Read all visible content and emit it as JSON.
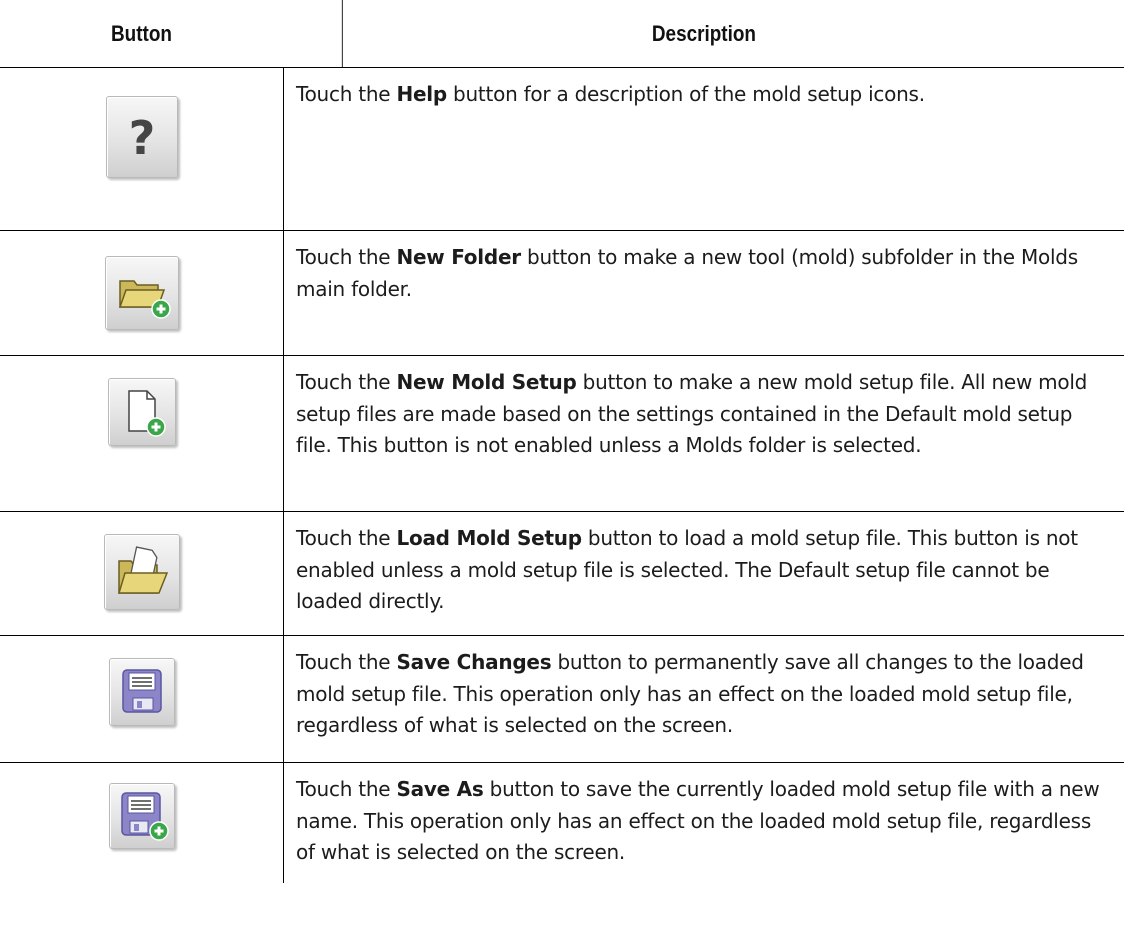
{
  "table": {
    "header": {
      "button": "Button",
      "description": "Description"
    },
    "rows": [
      {
        "icon": "help-icon",
        "pre": "Touch the ",
        "name": "Help",
        "post": " button for a description of the mold setup icons."
      },
      {
        "icon": "new-folder-icon",
        "pre": "Touch the ",
        "name": "New Folder",
        "post": " button to make a new tool (mold) subfolder in the Molds main folder."
      },
      {
        "icon": "new-mold-setup-icon",
        "pre": "Touch the ",
        "name": "New Mold Setup",
        "post": " button to make a new mold setup file. All new mold setup files are made based on the settings contained in the Default mold setup file. This button is not enabled unless a Molds folder is selected."
      },
      {
        "icon": "load-mold-setup-icon",
        "pre": "Touch the ",
        "name": "Load Mold Setup",
        "post": " button to load a mold setup file. This button is not enabled unless a mold setup file is selected. The Default setup file cannot be loaded directly."
      },
      {
        "icon": "save-changes-icon",
        "pre": "Touch the ",
        "name": "Save Changes",
        "post": " button to permanently save all changes to the loaded mold setup file. This operation only has an effect on the loaded mold setup file, regardless of what is selected on the screen."
      },
      {
        "icon": "save-as-icon",
        "pre": "Touch the ",
        "name": "Save As",
        "post": " button to save the currently loaded mold setup file with a new name. This operation only has an effect on the loaded mold setup file, regardless of what is selected on the screen."
      }
    ]
  },
  "colors": {
    "folder_yellow": "#e7d77a",
    "plus_green": "#3aa64a",
    "floppy_blue": "#8c86c8",
    "rule": "#000000"
  }
}
